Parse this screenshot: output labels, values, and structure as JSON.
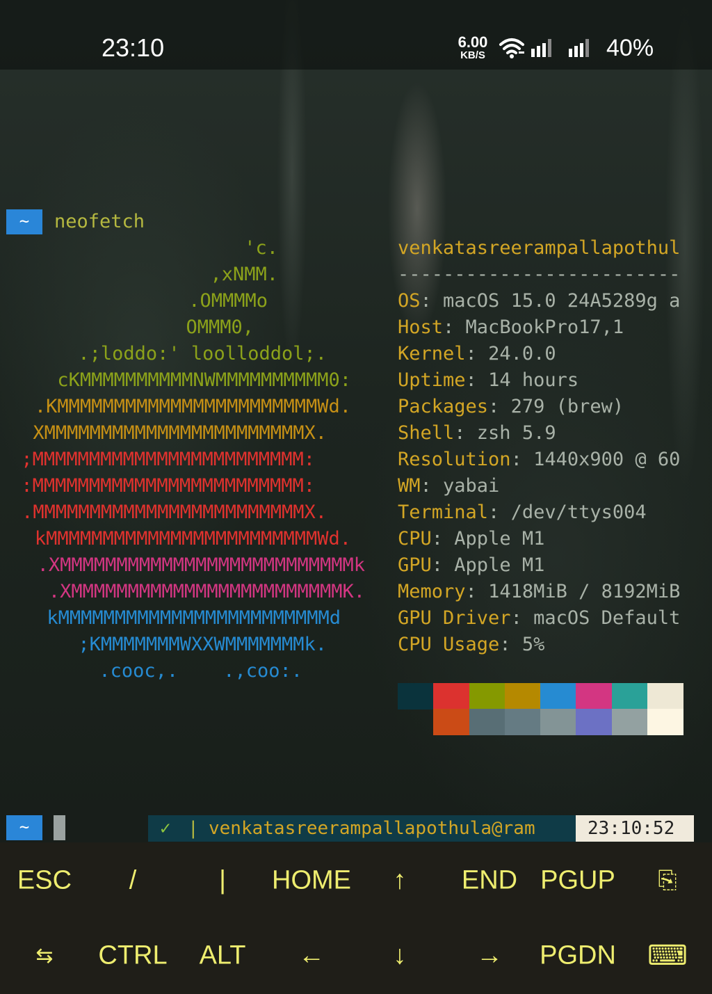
{
  "status_bar": {
    "time": "23:10",
    "net_speed": "6.00",
    "net_unit": "KB/S",
    "battery": "40%",
    "icons": [
      "wifi-icon",
      "signal-icon",
      "signal-icon"
    ]
  },
  "terminal": {
    "prompt_symbol": "~",
    "command": "neofetch",
    "ascii_art": [
      {
        "text": "'c.",
        "color": "#8ca21a"
      },
      {
        "text": ",xNMM.",
        "color": "#8ca21a"
      },
      {
        "text": ".OMMMMo",
        "color": "#8ca21a"
      },
      {
        "text": "OMMM0,",
        "color": "#8ca21a"
      },
      {
        "text": ".;loddo:' loolloddol;.",
        "color": "#8ca21a"
      },
      {
        "text": "cKMMMMMMMMMMNWMMMMMMMMMM0:",
        "color": "#8ca21a"
      },
      {
        "text": ".KMMMMMMMMMMMMMMMMMMMMMMMWd.",
        "color": "#c69015"
      },
      {
        "text": "XMMMMMMMMMMMMMMMMMMMMMMMX.",
        "color": "#c69015"
      },
      {
        "text": ";MMMMMMMMMMMMMMMMMMMMMMMM:",
        "color": "#e0322e"
      },
      {
        "text": ":MMMMMMMMMMMMMMMMMMMMMMMM:",
        "color": "#e0322e"
      },
      {
        "text": ".MMMMMMMMMMMMMMMMMMMMMMMMX.",
        "color": "#e0322e"
      },
      {
        "text": "kMMMMMMMMMMMMMMMMMMMMMMMMWd.",
        "color": "#e0322e"
      },
      {
        "text": ".XMMMMMMMMMMMMMMMMMMMMMMMMMMk",
        "color": "#d33682"
      },
      {
        "text": ".XMMMMMMMMMMMMMMMMMMMMMMMMK.",
        "color": "#d33682"
      },
      {
        "text": "kMMMMMMMMMMMMMMMMMMMMMMMMd",
        "color": "#268bd2"
      },
      {
        "text": ";KMMMMMMMWXXWMMMMMMMk.",
        "color": "#268bd2"
      },
      {
        "text": ".cooc,.    .,coo:.",
        "color": "#268bd2"
      }
    ],
    "user_host": "venkatasreerampallapothul",
    "divider": "-------------------------",
    "info": [
      {
        "key": "OS",
        "value": "macOS 15.0 24A5289g a"
      },
      {
        "key": "Host",
        "value": "MacBookPro17,1"
      },
      {
        "key": "Kernel",
        "value": "24.0.0"
      },
      {
        "key": "Uptime",
        "value": "14 hours"
      },
      {
        "key": "Packages",
        "value": "279 (brew)"
      },
      {
        "key": "Shell",
        "value": "zsh 5.9"
      },
      {
        "key": "Resolution",
        "value": "1440x900 @ 60"
      },
      {
        "key": "WM",
        "value": "yabai"
      },
      {
        "key": "Terminal",
        "value": "/dev/ttys004"
      },
      {
        "key": "CPU",
        "value": "Apple M1"
      },
      {
        "key": "GPU",
        "value": "Apple M1"
      },
      {
        "key": "Memory",
        "value": "1418MiB / 8192MiB"
      },
      {
        "key": "GPU Driver",
        "value": "macOS Default"
      },
      {
        "key": "CPU Usage",
        "value": "5%"
      }
    ],
    "palette_row1": [
      "#073642",
      "#dc322f",
      "#859900",
      "#b58900",
      "#268bd2",
      "#d33682",
      "#2aa198",
      "#eee8d5"
    ],
    "palette_row2": [
      "#002b36",
      "#cb4b16",
      "#586e75",
      "#657b83",
      "#839496",
      "#6c71c4",
      "#93a1a1",
      "#fdf6e3"
    ],
    "prompt": {
      "symbol": "~",
      "check": "✓",
      "pipe": "|",
      "host": "venkatasreerampallapothula@ram",
      "time": "23:10:52"
    }
  },
  "extra_keys": {
    "row1": [
      "ESC",
      "/",
      "|",
      "HOME",
      "↑",
      "END",
      "PGUP",
      "⎘"
    ],
    "row2": [
      "⇆",
      "CTRL",
      "ALT",
      "←",
      "↓",
      "→",
      "PGDN",
      "⌨"
    ]
  }
}
